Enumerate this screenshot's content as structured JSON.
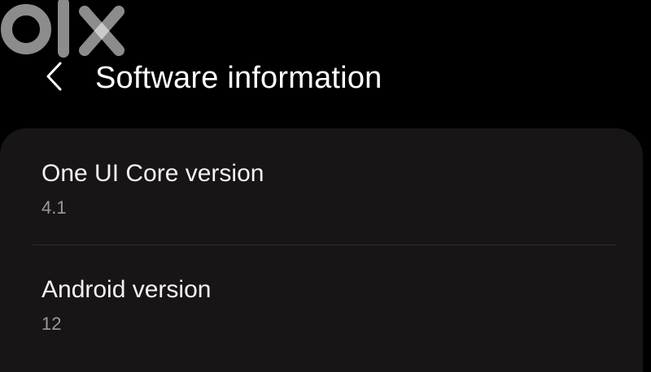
{
  "watermark": {
    "text": "olx",
    "icon": "olx-logo-icon"
  },
  "header": {
    "back_icon": "chevron-left-icon",
    "title": "Software information"
  },
  "items": [
    {
      "title": "One UI Core version",
      "value": "4.1"
    },
    {
      "title": "Android version",
      "value": "12"
    }
  ],
  "colors": {
    "background": "#000000",
    "card": "#171515",
    "title_text": "#ffffff",
    "value_text": "#9a9a9a",
    "divider": "#2f2c2c"
  }
}
